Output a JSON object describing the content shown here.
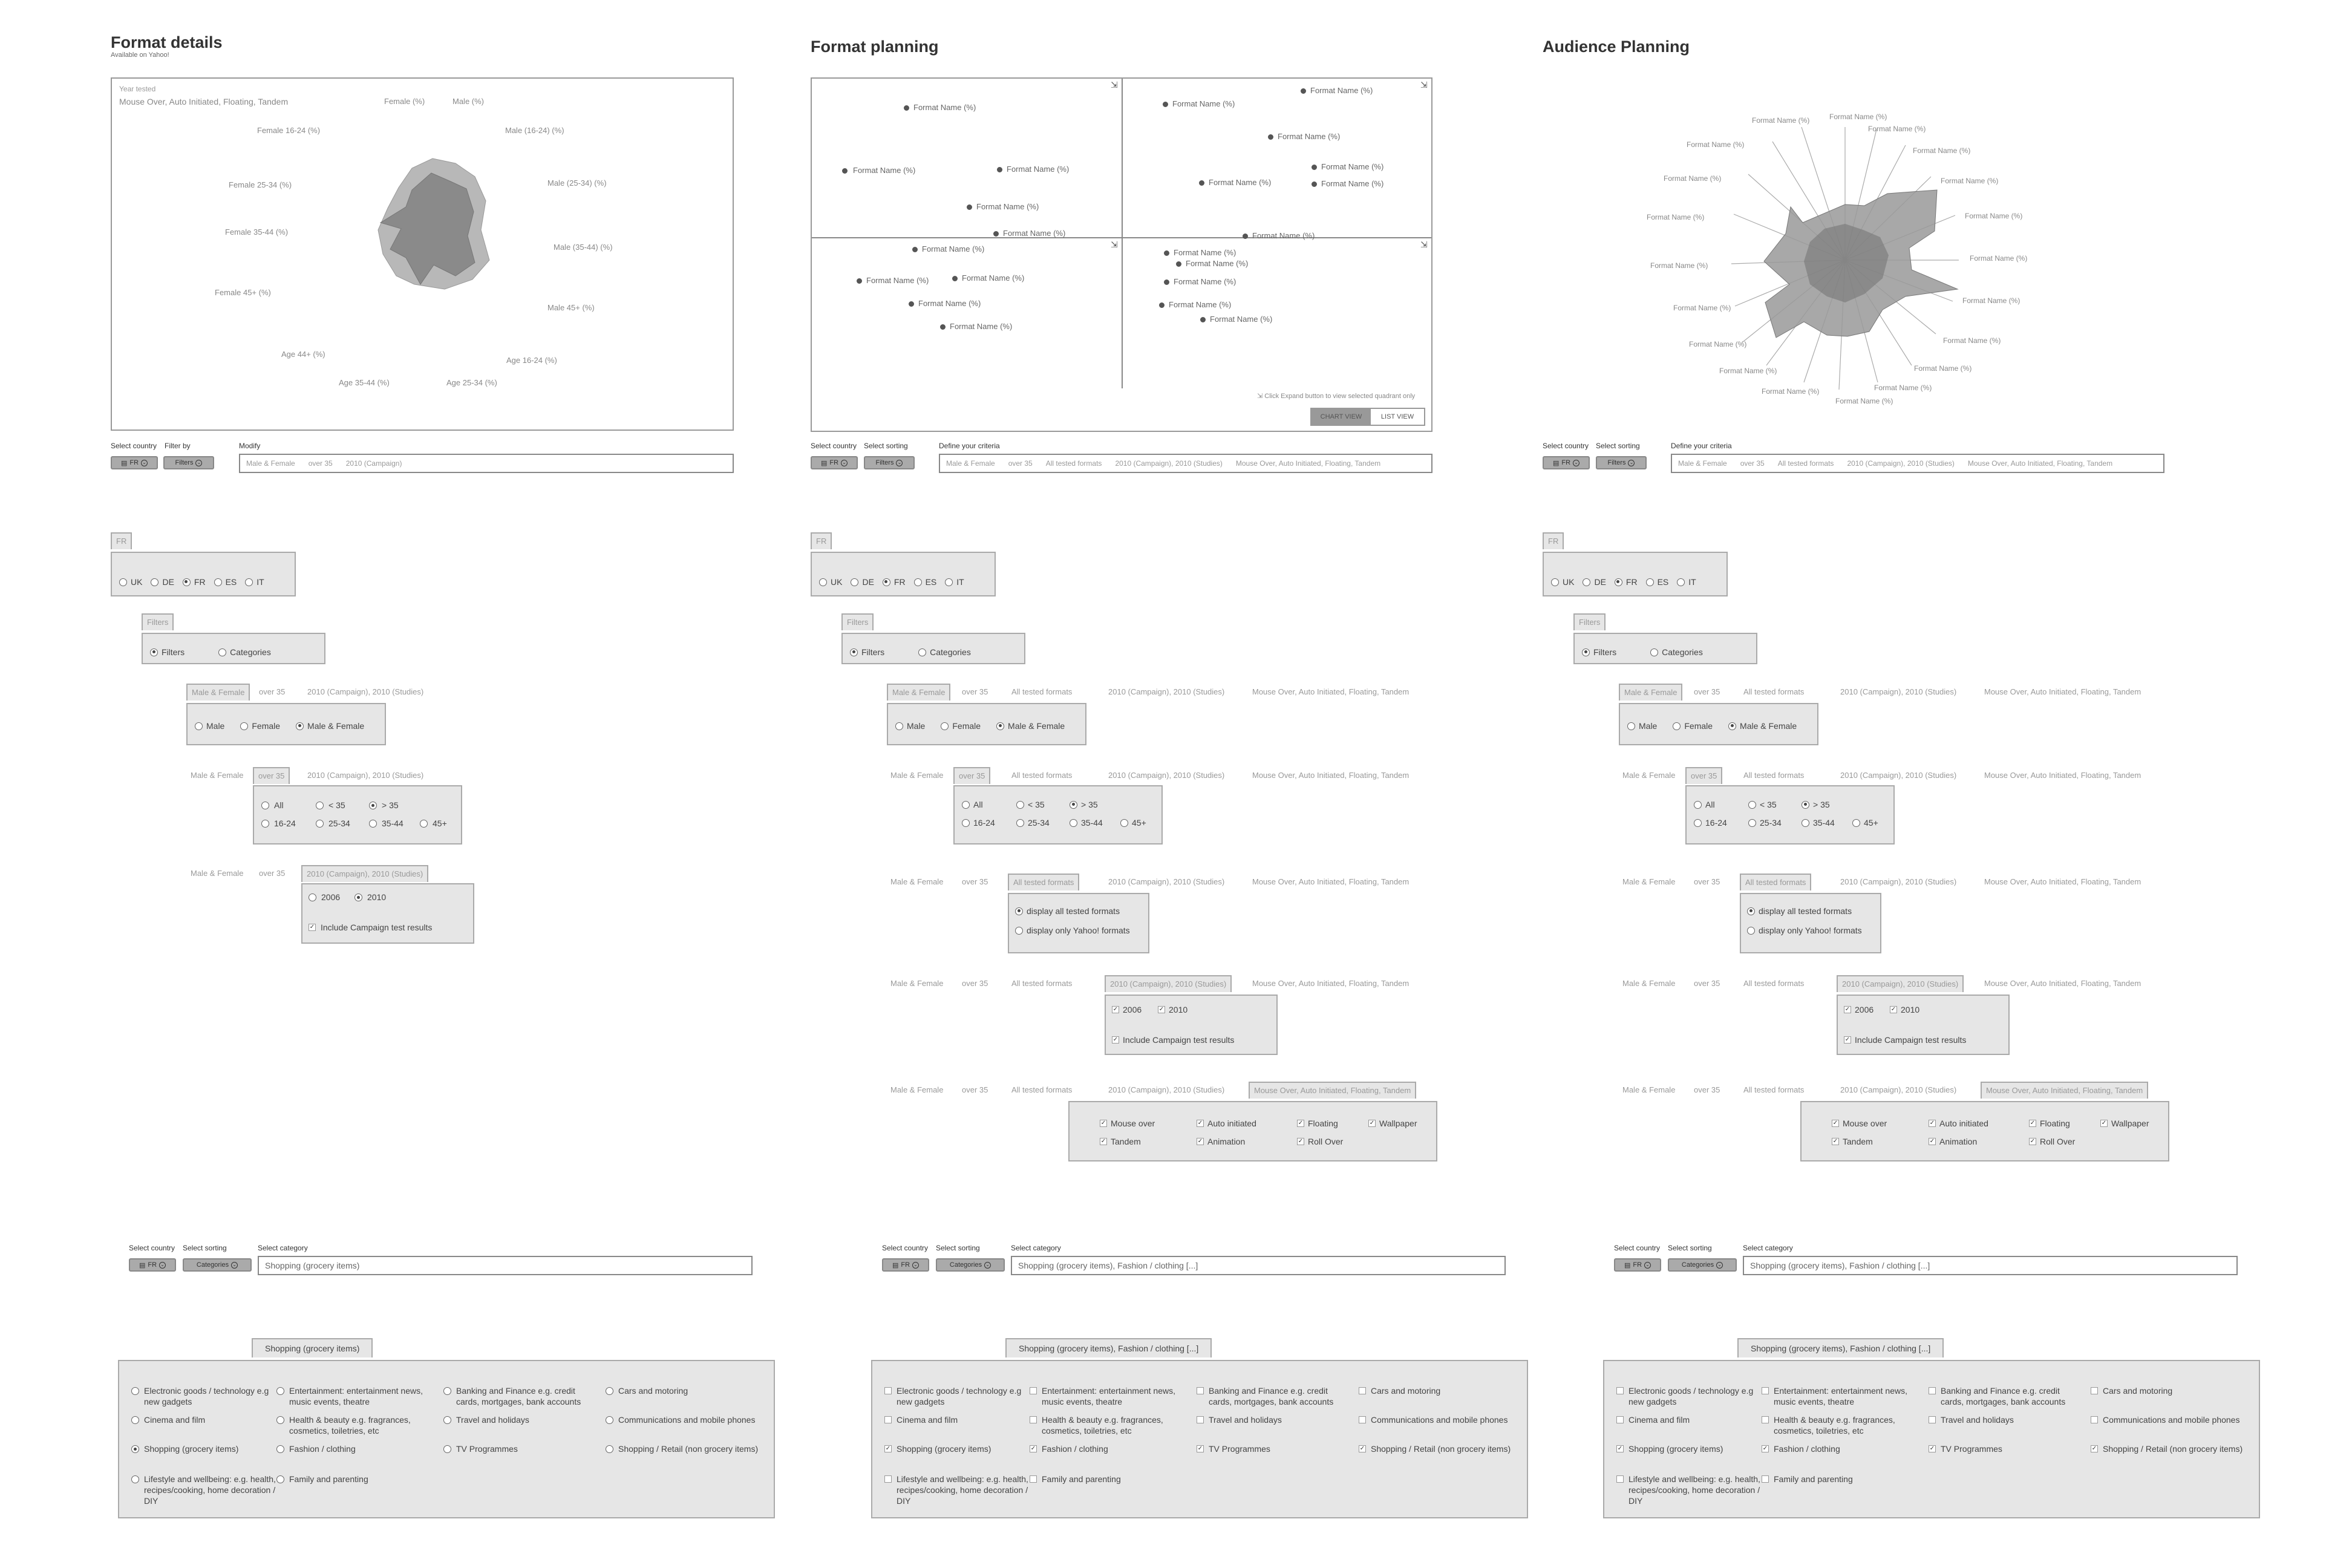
{
  "col1": {
    "title": "Format details",
    "subtitle": "Available on Yahoo!",
    "year_tested_label": "Year tested",
    "year_tested_value": "Mouse Over, Auto Initiated, Floating, Tandem",
    "radar_labels": [
      "Female (%)",
      "Male (%)",
      "Female 16-24  (%)",
      "Male (16-24) (%)",
      "Female 25-34 (%)",
      "Male (25-34) (%)",
      "Female 35-44 (%)",
      "Male (35-44) (%)",
      "Female 45+  (%)",
      "Male 45+ (%)",
      "Age 44+  (%)",
      "Age 16-24  (%)",
      "Age 35-44  (%)",
      "Age 25-34  (%)"
    ],
    "bar": {
      "select_country": "Select country",
      "filter_by": "Filter by",
      "modify": "Modify",
      "country_val": "FR",
      "filter_val": "Filters",
      "criteria": [
        "Male & Female",
        "over 35",
        "2010 (Campaign)"
      ]
    }
  },
  "col2": {
    "title": "Format planning",
    "quadrant_point_label": "Format Name (%)",
    "expand_hint": "Click Expand button to view selected quadrant only",
    "chart_view": "CHART VIEW",
    "list_view": "LIST VIEW",
    "bar": {
      "select_country": "Select country",
      "select_sorting": "Select sorting",
      "define_criteria": "Define your criteria",
      "country_val": "FR",
      "filter_val": "Filters",
      "criteria": [
        "Male & Female",
        "over 35",
        "All tested formats",
        "2010 (Campaign), 2010 (Studies)",
        "Mouse Over, Auto Initiated, Floating, Tandem"
      ]
    }
  },
  "col3": {
    "title": "Audience Planning",
    "radar_label": "Format Name (%)",
    "bar": {
      "select_country": "Select country",
      "select_sorting": "Select sorting",
      "define_criteria": "Define your criteria",
      "country_val": "FR",
      "filter_val": "Filters",
      "criteria": [
        "Male & Female",
        "over 35",
        "All tested formats",
        "2010 (Campaign), 2010 (Studies)",
        "Mouse Over, Auto Initiated, Floating, Tandem"
      ]
    }
  },
  "country_tab": "FR",
  "countries": [
    "UK",
    "DE",
    "FR",
    "ES",
    "IT"
  ],
  "filters_tab": "Filters",
  "filters_options": [
    "Filters",
    "Categories"
  ],
  "crumbs": {
    "gender": "Male & Female",
    "age": "over 35",
    "formats": "All tested formats",
    "year": "2010 (Campaign), 2010 (Studies)",
    "types": "Mouse Over, Auto Initiated, Floating, Tandem"
  },
  "gender_options": [
    "Male",
    "Female",
    "Male & Female"
  ],
  "age_options": [
    "All",
    "< 35",
    "> 35",
    "16-24",
    "25-34",
    "35-44",
    "45+"
  ],
  "year_options": [
    "2006",
    "2010"
  ],
  "include_campaign": "Include Campaign test results",
  "format_options": [
    "display all tested formats",
    "display only Yahoo! formats"
  ],
  "type_options": [
    "Mouse over",
    "Auto initiated",
    "Floating",
    "Wallpaper",
    "Tandem",
    "Animation",
    "Roll Over"
  ],
  "cat_bar": {
    "select_country": "Select country",
    "select_sorting": "Select sorting",
    "select_category": "Select category",
    "country_val": "FR",
    "sort_val": "Categories",
    "value1": "Shopping (grocery items)",
    "value2": "Shopping (grocery items), Fashion / clothing [...]"
  },
  "cat_tab1": "Shopping (grocery items)",
  "cat_tab2": "Shopping (grocery items), Fashion / clothing [...]",
  "categories": [
    "Electronic goods / technology e.g new gadgets",
    "Entertainment: entertainment news, music events, theatre",
    "Banking and Finance e.g. credit cards, mortgages, bank accounts",
    "Cars and motoring",
    "Cinema and film",
    "Health & beauty e.g. fragrances, cosmetics, toiletries, etc",
    "Travel and holidays",
    "Communications and mobile phones",
    "Shopping (grocery items)",
    "Fashion / clothing",
    "TV Programmes",
    "Shopping / Retail (non grocery items)",
    "Lifestyle and wellbeing: e.g. health, recipes/cooking, home decoration / DIY",
    "Family and parenting"
  ],
  "icons": {
    "expand": "expand-icon",
    "dropdown": "chevron-circle-icon",
    "flag": "flag-icon"
  }
}
